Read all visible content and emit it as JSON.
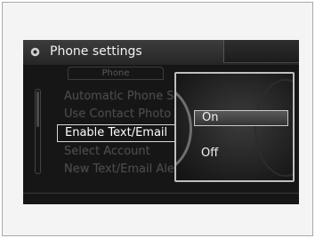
{
  "header": {
    "title": "Phone settings",
    "icon": "gear-icon"
  },
  "tab": {
    "label": "Phone"
  },
  "menu": {
    "items": [
      {
        "label": "Automatic Phone Sync",
        "state": "dimmed"
      },
      {
        "label": "Use Contact Photo",
        "state": "dimmed"
      },
      {
        "label": "Enable Text/Email",
        "state": "highlighted"
      },
      {
        "label": "Select Account",
        "state": "dimmed"
      },
      {
        "label": "New Text/Email Alert",
        "state": "dimmed"
      }
    ]
  },
  "popup": {
    "options": [
      {
        "label": "On",
        "selected": true
      },
      {
        "label": "Off",
        "selected": false
      }
    ]
  },
  "colors": {
    "screen_background": "#161616",
    "highlight_border": "#d8d8d8",
    "dimmed_text": "#4a4a4a",
    "active_text": "#ffffff"
  }
}
